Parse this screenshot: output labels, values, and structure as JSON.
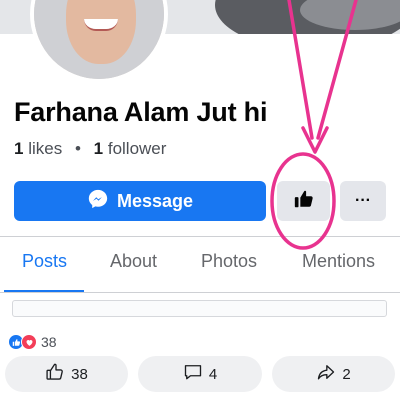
{
  "profile": {
    "name": "Farhana Alam Jut hi",
    "likes_count": "1",
    "likes_label": "likes",
    "separator": "•",
    "followers_count": "1",
    "followers_label": "follower"
  },
  "buttons": {
    "message_label": "Message",
    "more_label": "···"
  },
  "tabs": [
    {
      "label": "Posts",
      "active": true
    },
    {
      "label": "About",
      "active": false
    },
    {
      "label": "Photos",
      "active": false
    },
    {
      "label": "Mentions",
      "active": false
    }
  ],
  "post": {
    "reaction_count": "38",
    "actions": {
      "like_count": "38",
      "comment_count": "4",
      "share_count": "2"
    }
  },
  "colors": {
    "brand_blue": "#1877f2",
    "annotation_pink": "#e8338f",
    "button_gray": "#e4e6eb"
  },
  "icons": {
    "message": "messenger-icon",
    "like": "thumbs-up-icon",
    "more": "more-dots-icon",
    "comment": "comment-icon",
    "share": "share-icon",
    "reaction_like": "like-reaction-icon",
    "reaction_love": "love-reaction-icon"
  }
}
